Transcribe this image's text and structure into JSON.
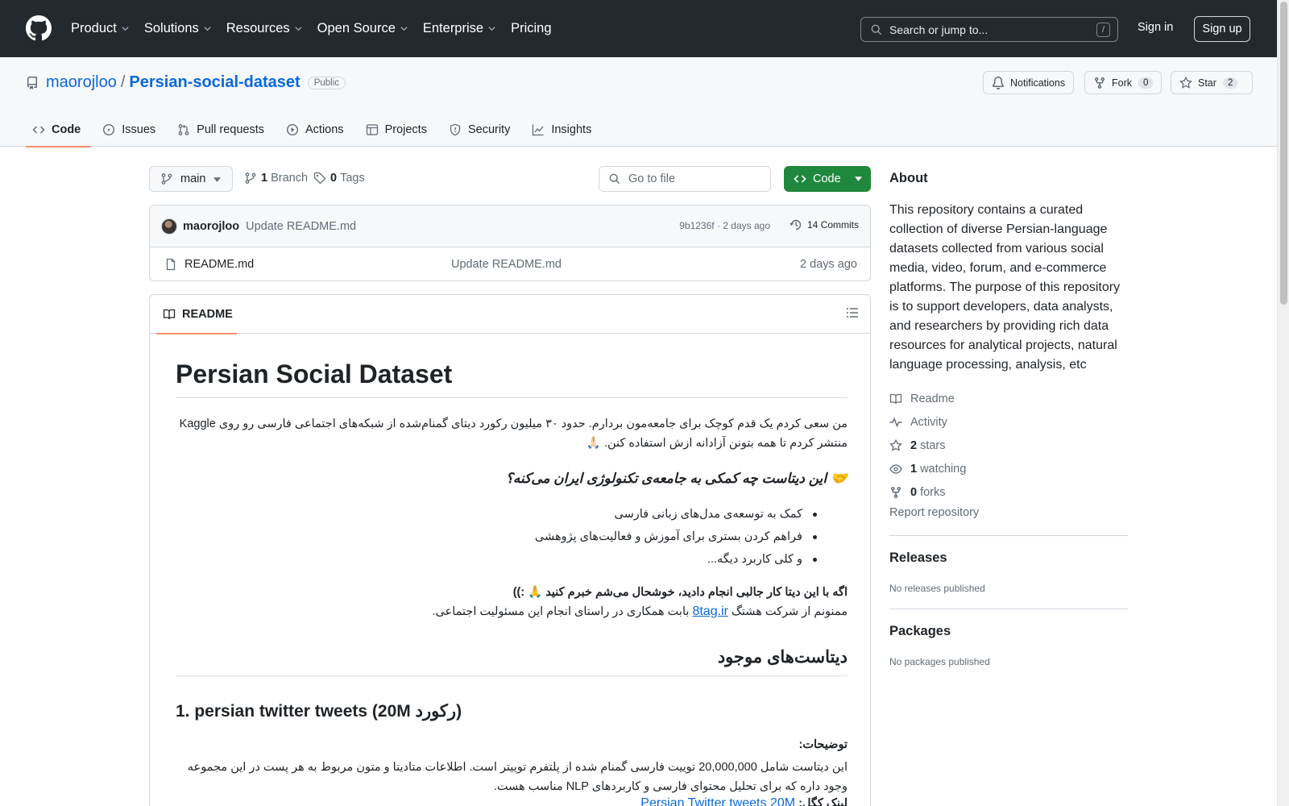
{
  "header": {
    "nav": [
      "Product",
      "Solutions",
      "Resources",
      "Open Source",
      "Enterprise",
      "Pricing"
    ],
    "search_placeholder": "Search or jump to...",
    "search_shortcut": "/",
    "sign_in": "Sign in",
    "sign_up": "Sign up"
  },
  "repo": {
    "owner": "maorojloo",
    "separator": "/",
    "name": "Persian-social-dataset",
    "visibility": "Public",
    "notifications": "Notifications",
    "fork_label": "Fork",
    "fork_count": "0",
    "star_label": "Star",
    "star_count": "2",
    "tabs": [
      "Code",
      "Issues",
      "Pull requests",
      "Actions",
      "Projects",
      "Security",
      "Insights"
    ]
  },
  "filebar": {
    "branch": "main",
    "branch_count": "1",
    "branch_label": "Branch",
    "tag_count": "0",
    "tag_label": "Tags",
    "go_to_file": "Go to file",
    "code_button": "Code"
  },
  "commit": {
    "author": "maorojloo",
    "message": "Update README.md",
    "meta": "9b1236f · 2 days ago",
    "commits": "14 Commits"
  },
  "files": [
    {
      "name": "README.md",
      "commit": "Update README.md",
      "age": "2 days ago"
    }
  ],
  "readme": {
    "tab": "README",
    "title": "Persian Social Dataset",
    "intro": "من سعی کردم یک قدم کوچک برای جامعه‌مون بردارم. حدود ۳۰ میلیون رکورد دیتای گمنام‌شده از شبکه‌های اجتماعی فارسی رو روی Kaggle منتشر کردم تا همه بتونن آزادانه ازش استفاده کنن. 🙏🏻",
    "question": "🤝 این دیتاست چه کمکی به جامعه‌ی تکنولوژی ایران می‌کنه؟",
    "bullets": [
      "کمک به توسعه‌ی مدل‌های زبانی فارسی",
      "فراهم کردن بستری برای آموزش و فعالیت‌های پژوهشی",
      "و کلی کاربرد دیگه..."
    ],
    "thanks_bold": "اگه با این دیتا کار جالبی انجام دادید، خوشحال می‌شم خبرم کنید 🙏 :))",
    "thanks_pre": "ممنونم از شرکت هشتگ",
    "thanks_link": "8tag.ir",
    "thanks_post": "بابت همکاری در راستای انجام این مسئولیت اجتماعی.",
    "available_heading": "دیتاست‌های موجود",
    "dataset_heading": "1. persian twitter tweets (20M رکورد)",
    "desc_label": "توضیحات:",
    "desc": "این دیتاست شامل 20,000,000 توییت فارسی گمنام شده از پلتفرم توییتر است. اطلاعات متادیتا و متون مربوط به هر پست در این مجموعه وجود داره که برای تحلیل محتوای فارسی و کاربردهای NLP مناسب هست.",
    "kaggle_label": "لینک کگل:",
    "kaggle_link": "Persian Twitter tweets 20M"
  },
  "sidebar": {
    "about_heading": "About",
    "about_text": "This repository contains a curated collection of diverse Persian-language datasets collected from various social media, video, forum, and e-commerce platforms. The purpose of this repository is to support developers, data analysts, and researchers by providing rich data resources for analytical projects, natural language processing, analysis, etc",
    "readme": "Readme",
    "activity": "Activity",
    "stars_count": "2",
    "stars_label": "stars",
    "watching_count": "1",
    "watching_label": "watching",
    "forks_count": "0",
    "forks_label": "forks",
    "report": "Report repository",
    "releases_heading": "Releases",
    "releases_sub": "No releases published",
    "packages_heading": "Packages",
    "packages_sub": "No packages published"
  }
}
